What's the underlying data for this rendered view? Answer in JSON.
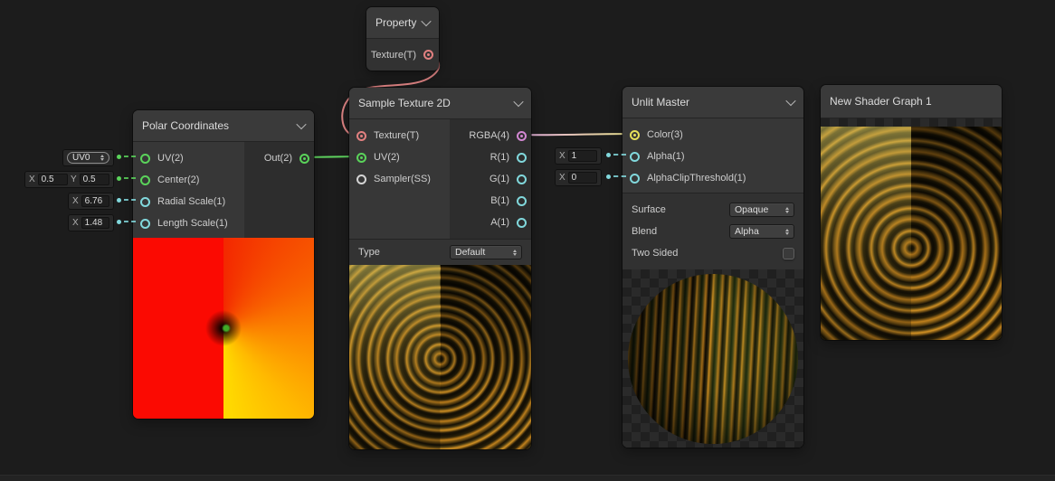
{
  "css_vars": {
    "canvas-bg": "#1c1c1c",
    "node-header-bg": "#3a3a3a",
    "port-texture": "#e28080",
    "port-vector1": "#81d8dc",
    "port-vector2": "#5ad35a",
    "port-vector3": "#e6e15a",
    "port-vector4": "#d287d2",
    "port-sampler": "#d4d4d4",
    "wire-texture": "#df8484",
    "wire-vector2": "#5fd45f",
    "wire-rgba-start": "#e0aadc",
    "wire-rgba-end": "#eae48c",
    "accent-red": "#fb0a02",
    "accent-orange": "#fc8d00",
    "accent-yellow": "#ffd800"
  },
  "graph": {
    "property_node": {
      "title": "Property",
      "output_label": "Texture(T)"
    },
    "polar_node": {
      "title": "Polar Coordinates",
      "inputs": [
        {
          "label": "UV(2)"
        },
        {
          "label": "Center(2)"
        },
        {
          "label": "Radial Scale(1)"
        },
        {
          "label": "Length Scale(1)"
        }
      ],
      "output_label": "Out(2)",
      "widgets": {
        "uv_channel": {
          "value": "UV0"
        },
        "center": {
          "x_label": "X",
          "x_value": "0.5",
          "y_label": "Y",
          "y_value": "0.5"
        },
        "radial_scale": {
          "label": "X",
          "value": "6.76"
        },
        "length_scale": {
          "label": "X",
          "value": "1.48"
        }
      }
    },
    "sample_node": {
      "title": "Sample Texture 2D",
      "inputs": [
        {
          "label": "Texture(T)"
        },
        {
          "label": "UV(2)"
        },
        {
          "label": "Sampler(SS)"
        }
      ],
      "outputs": [
        {
          "label": "RGBA(4)"
        },
        {
          "label": "R(1)"
        },
        {
          "label": "G(1)"
        },
        {
          "label": "B(1)"
        },
        {
          "label": "A(1)"
        }
      ],
      "type_label": "Type",
      "type_value": "Default"
    },
    "unlit_node": {
      "title": "Unlit Master",
      "inputs": [
        {
          "label": "Color(3)"
        },
        {
          "label": "Alpha(1)"
        },
        {
          "label": "AlphaClipThreshold(1)"
        }
      ],
      "widgets": {
        "alpha": {
          "label": "X",
          "value": "1"
        },
        "alpha_clip": {
          "label": "X",
          "value": "0"
        }
      },
      "surface_label": "Surface",
      "surface_value": "Opaque",
      "blend_label": "Blend",
      "blend_value": "Alpha",
      "two_sided_label": "Two Sided",
      "two_sided_checked": false
    },
    "master_node": {
      "title": "New Shader Graph 1"
    }
  }
}
